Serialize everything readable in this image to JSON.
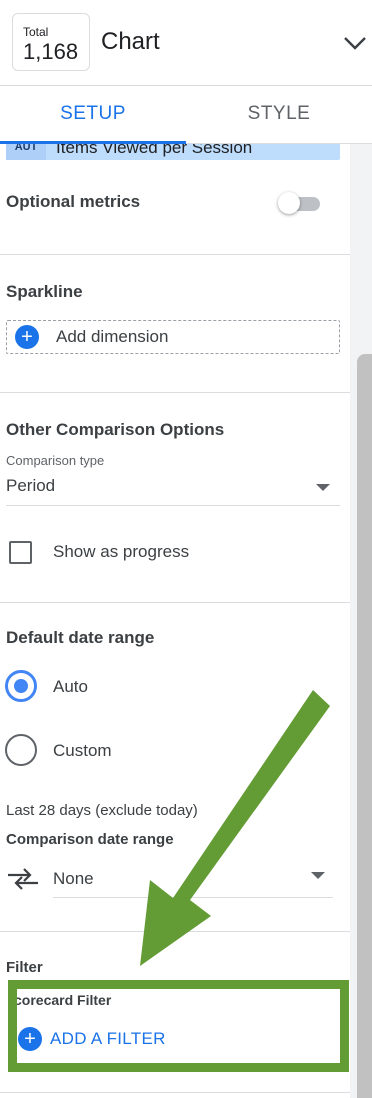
{
  "header": {
    "chart_icon": {
      "label": "Total",
      "value": "1,168"
    },
    "title": "Chart",
    "collapse_icon": "chevron-down-icon"
  },
  "tabs": [
    {
      "label": "SETUP",
      "active": true
    },
    {
      "label": "STYLE",
      "active": false
    }
  ],
  "metric": {
    "badge": "AUT",
    "label": "Items Viewed per Session"
  },
  "optional_metrics": {
    "title": "Optional metrics",
    "enabled": false
  },
  "sparkline": {
    "title": "Sparkline",
    "add_dimension": "Add dimension"
  },
  "comparison": {
    "title": "Other Comparison Options",
    "type_label": "Comparison type",
    "type_value": "Period",
    "show_as_progress": "Show as progress"
  },
  "date_range": {
    "title": "Default date range",
    "options": [
      {
        "label": "Auto",
        "selected": true
      },
      {
        "label": "Custom",
        "selected": false
      }
    ],
    "auto_hint": "Last 28 days (exclude today)",
    "comparison_title": "Comparison date range",
    "comparison_value": "None"
  },
  "filter": {
    "title": "Filter",
    "scorecard_label": "corecard Filter",
    "add_filter": "ADD A FILTER"
  },
  "colors": {
    "accent": "#1a73e8",
    "annotation_green": "#639b34",
    "chip_blue": "#bedcfb",
    "radio_blue": "#4285f4"
  }
}
